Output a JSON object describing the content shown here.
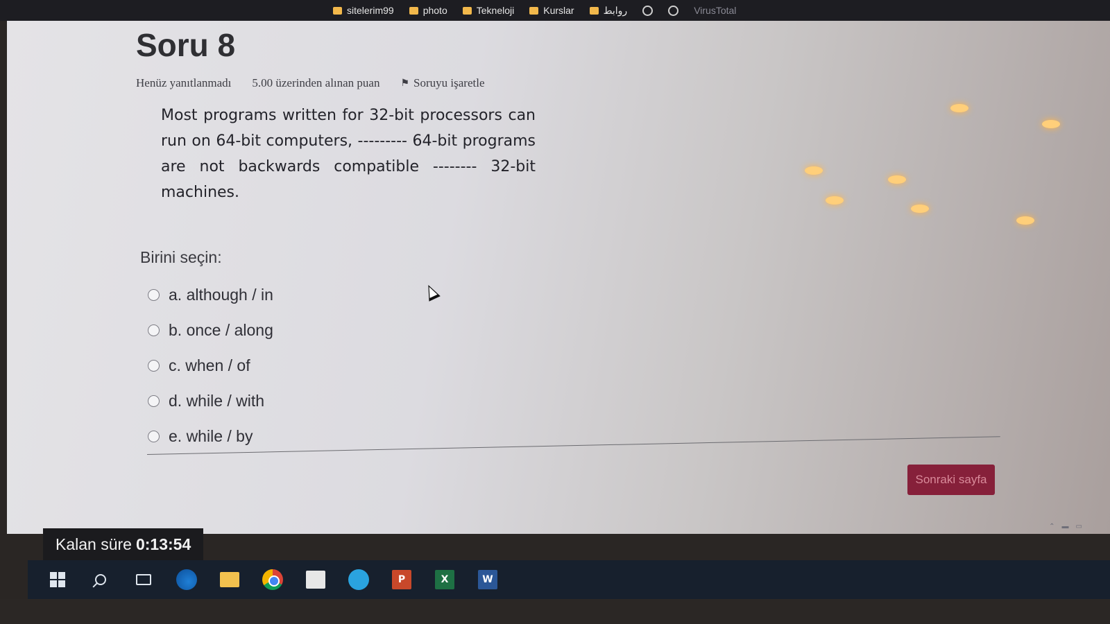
{
  "bookmarks": {
    "items": [
      {
        "label": "sitelerim99",
        "icon": "folder-icon"
      },
      {
        "label": "photo",
        "icon": "folder-icon"
      },
      {
        "label": "Tekneloji",
        "icon": "folder-icon"
      },
      {
        "label": "Kurslar",
        "icon": "folder-icon"
      },
      {
        "label": "روابط",
        "icon": "folder-icon"
      },
      {
        "label": "VirusTotal",
        "icon": "virustotal-icon"
      }
    ]
  },
  "question": {
    "title": "Soru 8",
    "status": "Henüz yanıtlanmadı",
    "points": "5.00 üzerinden alınan puan",
    "flag_label": "Soruyu işaretle",
    "text": "Most programs written for 32-bit processors can run on 64-bit computers, --------- 64-bit programs are not backwards compatible -------- 32-bit machines.",
    "prompt": "Birini seçin:",
    "options": [
      {
        "label": "a. although / in"
      },
      {
        "label": "b. once / along"
      },
      {
        "label": "c. when / of"
      },
      {
        "label": "d. while / with"
      },
      {
        "label": "e. while / by"
      }
    ]
  },
  "navigation": {
    "next_label": "Sonraki sayfa"
  },
  "timer": {
    "label": "Kalan süre",
    "value": "0:13:54"
  },
  "taskbar": {
    "ppt_glyph": "P",
    "excel_glyph": "X",
    "word_glyph": "W"
  },
  "colors": {
    "accent": "#86203a",
    "taskbar": "#17202d"
  }
}
